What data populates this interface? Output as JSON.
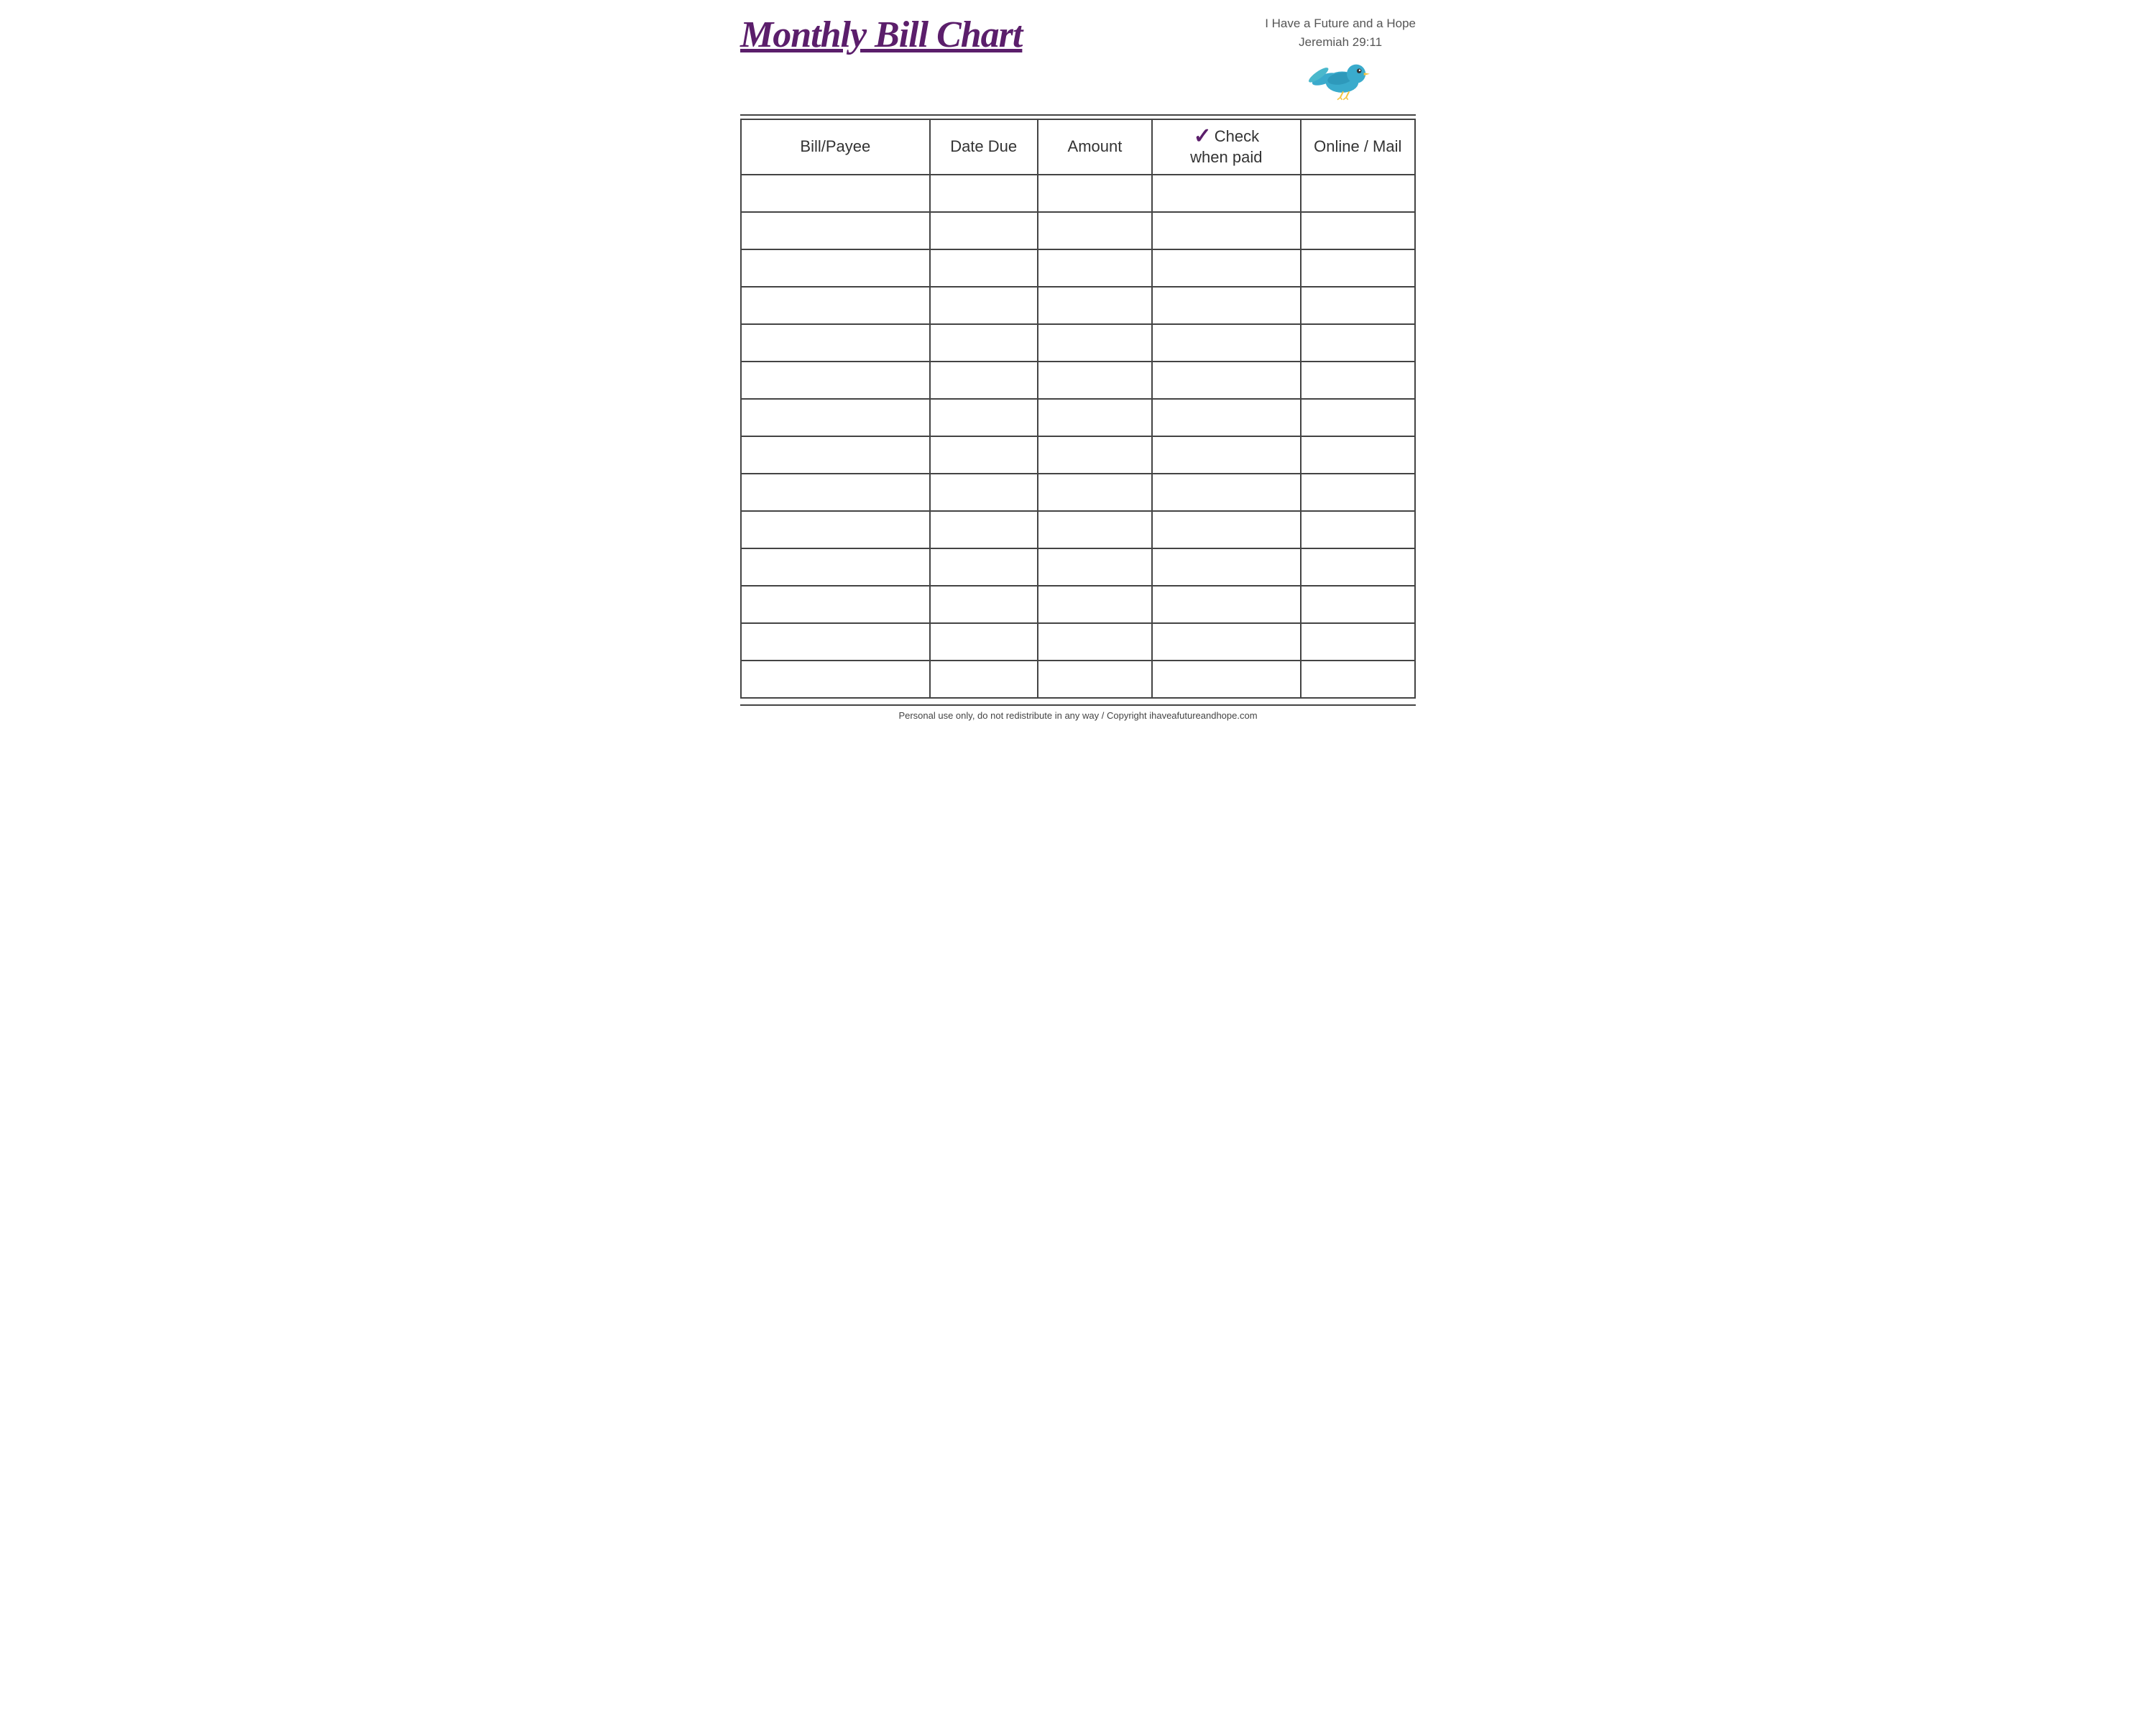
{
  "header": {
    "title": "Monthly Bill Chart",
    "subtitle_line1": "I Have a Future and a Hope",
    "subtitle_line2": "Jeremiah 29:11"
  },
  "table": {
    "columns": [
      {
        "key": "payee",
        "label": "Bill/Payee"
      },
      {
        "key": "date",
        "label": "Date Due"
      },
      {
        "key": "amount",
        "label": "Amount"
      },
      {
        "key": "check",
        "label_top": "Check",
        "label_bottom": "when paid"
      },
      {
        "key": "online",
        "label": "Online / Mail"
      }
    ],
    "row_count": 14
  },
  "footer": {
    "text": "Personal use only, do not redistribute in any way / Copyright ihaveafutureandhope.com"
  },
  "colors": {
    "title": "#5b1e6b",
    "checkmark": "#5b1e6b",
    "border": "#444",
    "text": "#333"
  }
}
